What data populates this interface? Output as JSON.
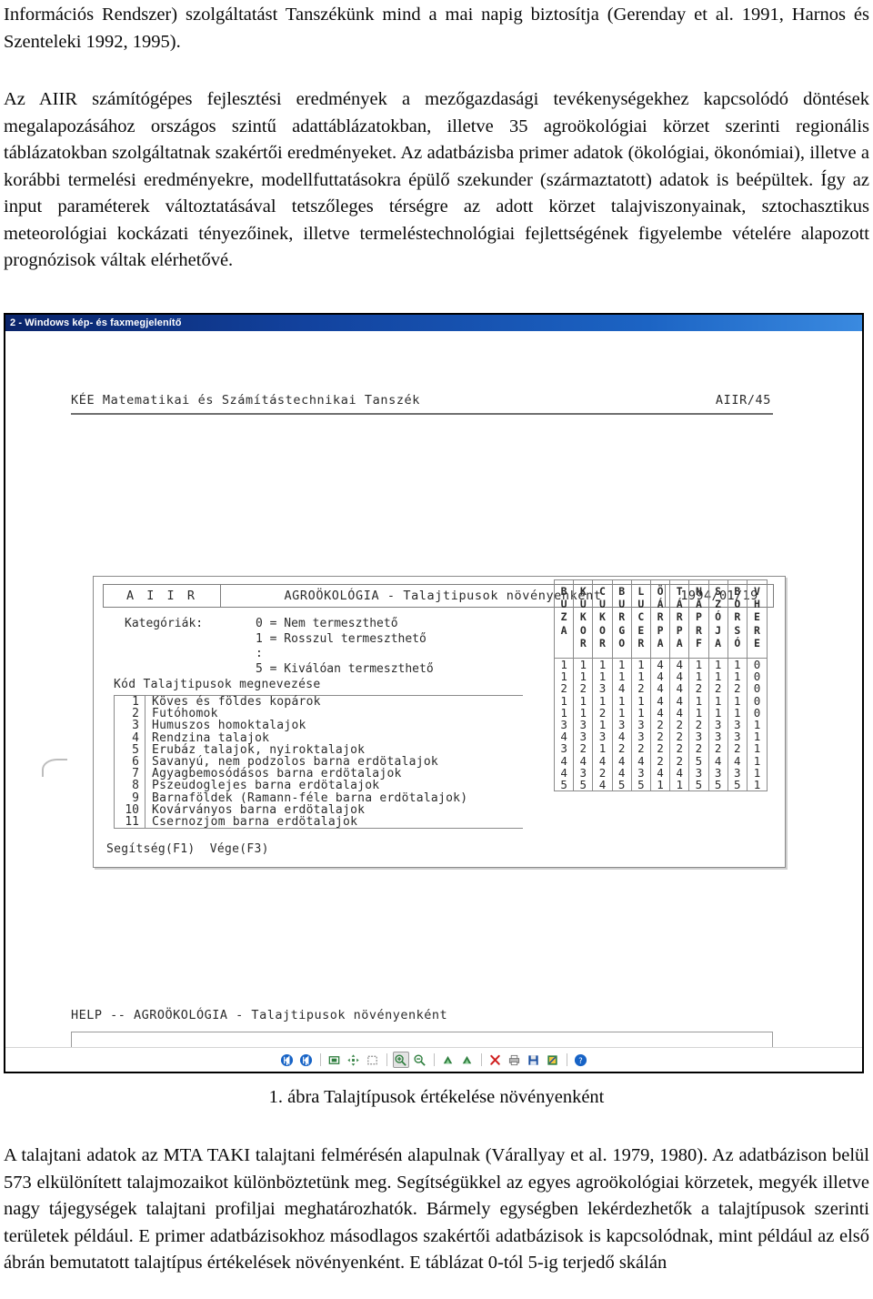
{
  "document": {
    "top_paragraphs": [
      "Információs Rendszer) szolgáltatást Tanszékünk mind a mai napig biztosítja (Gerenday et al. 1991, Harnos és Szenteleki 1992, 1995).",
      "Az AIIR számítógépes fejlesztési eredmények a mezőgazdasági tevékenységekhez kapcsolódó döntések megalapozásához országos szintű adattáblázatokban, illetve 35 agroökológiai körzet szerinti regionális táblázatokban szolgáltatnak szakértői eredményeket. Az adatbázisba primer adatok (ökológiai, ökonómiai), illetve a korábbi termelési eredményekre, modellfuttatásokra épülő szekunder (származtatott) adatok is beépültek. Így az input paraméterek változtatásával tetszőleges térségre az adott körzet talajviszonyainak, sztochasztikus meteorológiai kockázati tényezőinek, illetve termeléstechnológiai fejlettségének figyelembe vételére alapozott prognózisok váltak elérhetővé."
    ],
    "figure_caption": "1.   ábra Talajtípusok értékelése növényenként",
    "bottom_paragraph": "A talajtani adatok az MTA TAKI talajtani felmérésén alapulnak (Várallyay et al. 1979, 1980). Az adatbázison belül 573 elkülönített talajmozaikot különböztetünk meg. Segítségükkel az egyes agroökológiai körzetek, megyék illetve nagy tájegységek talajtani profiljai meghatározhatók. Bármely egységben lekérdezhetők a talajtípusok szerinti területek például. E primer adatbázisokhoz másodlagos szakértői adatbázisok is kapcsolódnak, mint például az első ábrán bemutatott talajtípus értékelések növényenként. E táblázat 0-tól 5-ig terjedő skálán"
  },
  "viewer": {
    "title": "2 - Windows kép- és faxmegjelenítő",
    "toolbar": [
      {
        "name": "first-image-icon",
        "glyph": "⏮",
        "style": "blue-round",
        "pressed": false
      },
      {
        "name": "next-image-icon",
        "glyph": "⏭",
        "style": "blue-round",
        "pressed": false
      },
      {
        "name": "separator",
        "glyph": "",
        "style": "sep",
        "pressed": false
      },
      {
        "name": "best-fit-icon",
        "glyph": "▣",
        "style": "green-outline",
        "pressed": false
      },
      {
        "name": "actual-size-icon",
        "glyph": "✥",
        "style": "green-solid",
        "pressed": false
      },
      {
        "name": "select-area-icon",
        "glyph": "▱",
        "style": "gray-outline",
        "pressed": false
      },
      {
        "name": "separator",
        "glyph": "",
        "style": "sep",
        "pressed": false
      },
      {
        "name": "zoom-in-icon",
        "glyph": "⊕",
        "style": "magnifier-plus",
        "pressed": true
      },
      {
        "name": "zoom-out-icon",
        "glyph": "⊖",
        "style": "magnifier-minus",
        "pressed": false
      },
      {
        "name": "separator",
        "glyph": "",
        "style": "sep",
        "pressed": false
      },
      {
        "name": "rotate-left-icon",
        "glyph": "↺",
        "style": "green-tri",
        "pressed": false
      },
      {
        "name": "rotate-right-icon",
        "glyph": "↻",
        "style": "green-tri",
        "pressed": false
      },
      {
        "name": "separator",
        "glyph": "",
        "style": "sep",
        "pressed": false
      },
      {
        "name": "delete-icon",
        "glyph": "✕",
        "style": "red-x",
        "pressed": false
      },
      {
        "name": "print-icon",
        "glyph": "⎙",
        "style": "printer",
        "pressed": false
      },
      {
        "name": "save-icon",
        "glyph": "💾",
        "style": "floppy",
        "pressed": false
      },
      {
        "name": "edit-image-icon",
        "glyph": "✎",
        "style": "edit",
        "pressed": false
      },
      {
        "name": "separator",
        "glyph": "",
        "style": "sep",
        "pressed": false
      },
      {
        "name": "help-icon",
        "glyph": "?",
        "style": "blue-round",
        "pressed": false
      }
    ]
  },
  "sheet": {
    "header_left": "KÉE Matematikai és Számítástechnikai Tanszék",
    "header_right": "AIIR/45",
    "help_line": "HELP -- AGROÖKOLÓGIA - Talajtipusok növényenként"
  },
  "form": {
    "app_code": "A I I R",
    "title": "AGROÖKOLÓGIA - Talajtipusok növényenként",
    "date": "1994/01/19",
    "legend_label": "Kategóriák:",
    "legend_lines": [
      "0 = Nem termeszthető",
      "1 = Rosszul termeszthető",
      ":",
      "5 = Kiválóan termeszthető"
    ],
    "kod_header": "Kód Talajtipusok megnevezése",
    "function_keys": "Segítség(F1)  Vége(F3)"
  },
  "chart_data": {
    "type": "table",
    "title": "AGROÖKOLÓGIA - Talajtipusok növényenként",
    "row_id_header": "Kód",
    "row_label_header": "Talajtipusok megnevezése",
    "column_headers": [
      "BUZA",
      "KUKOR",
      "CUKOR",
      "BURGO",
      "LUCER",
      "ÖÁRPA",
      "TÁRPA",
      "NAPRF",
      "SZÓJA",
      "BORSÓ",
      "VHERE"
    ],
    "scale": {
      "min": 0,
      "max": 5,
      "labels": {
        "0": "Nem termeszthető",
        "1": "Rosszul termeszthető",
        "5": "Kiválóan termeszthető"
      }
    },
    "rows": [
      {
        "code": "1",
        "label": "Köves és földes kopárok",
        "values": [
          1,
          1,
          1,
          1,
          1,
          4,
          4,
          1,
          1,
          1,
          0
        ]
      },
      {
        "code": "2",
        "label": "Futóhomok",
        "values": [
          1,
          1,
          1,
          1,
          1,
          4,
          4,
          1,
          1,
          1,
          0
        ]
      },
      {
        "code": "3",
        "label": "Humuszos homoktalajok",
        "values": [
          2,
          2,
          3,
          4,
          2,
          4,
          4,
          2,
          2,
          2,
          0
        ]
      },
      {
        "code": "4",
        "label": "Rendzina talajok",
        "values": [
          1,
          1,
          1,
          1,
          1,
          4,
          4,
          1,
          1,
          1,
          0
        ]
      },
      {
        "code": "5",
        "label": "Erubáz talajok, nyiroktalajok",
        "values": [
          1,
          1,
          2,
          1,
          1,
          4,
          4,
          1,
          1,
          1,
          0
        ]
      },
      {
        "code": "6",
        "label": "Savanyú, nem podzolos barna erdötalajok",
        "values": [
          3,
          3,
          1,
          3,
          3,
          2,
          2,
          2,
          3,
          3,
          1
        ]
      },
      {
        "code": "7",
        "label": "Agyagbemosódásos barna erdötalajok",
        "values": [
          4,
          3,
          3,
          4,
          3,
          2,
          2,
          3,
          3,
          3,
          1
        ]
      },
      {
        "code": "8",
        "label": "Pszeudoglejes barna erdötalajok",
        "values": [
          3,
          2,
          1,
          2,
          2,
          2,
          2,
          2,
          2,
          2,
          1
        ]
      },
      {
        "code": "9",
        "label": "Barnaföldek (Ramann-féle barna erdötalajok)",
        "values": [
          4,
          4,
          4,
          4,
          4,
          2,
          2,
          5,
          4,
          4,
          1
        ]
      },
      {
        "code": "10",
        "label": "Kovárványos barna erdötalajok",
        "values": [
          4,
          3,
          2,
          4,
          3,
          4,
          4,
          3,
          3,
          3,
          1
        ]
      },
      {
        "code": "11",
        "label": "Csernozjom barna erdötalajok",
        "values": [
          5,
          5,
          4,
          5,
          5,
          1,
          1,
          5,
          5,
          5,
          1
        ]
      }
    ]
  }
}
